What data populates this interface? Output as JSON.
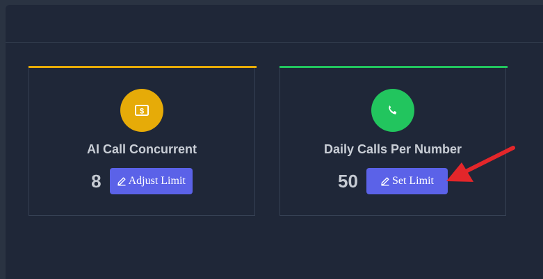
{
  "cards": [
    {
      "title": "AI Call Concurrent",
      "value": "8",
      "button_label": "Adjust Limit",
      "accent_color": "#e6ab08",
      "icon": "dollar-bill-icon",
      "icon_bg": "#e6ab08"
    },
    {
      "title": "Daily Calls Per Number",
      "value": "50",
      "button_label": "Set Limit",
      "accent_color": "#22c55e",
      "icon": "phone-icon",
      "icon_bg": "#22c55e"
    }
  ],
  "colors": {
    "button": "#5b62e8",
    "annotation_arrow": "#e3262a"
  }
}
